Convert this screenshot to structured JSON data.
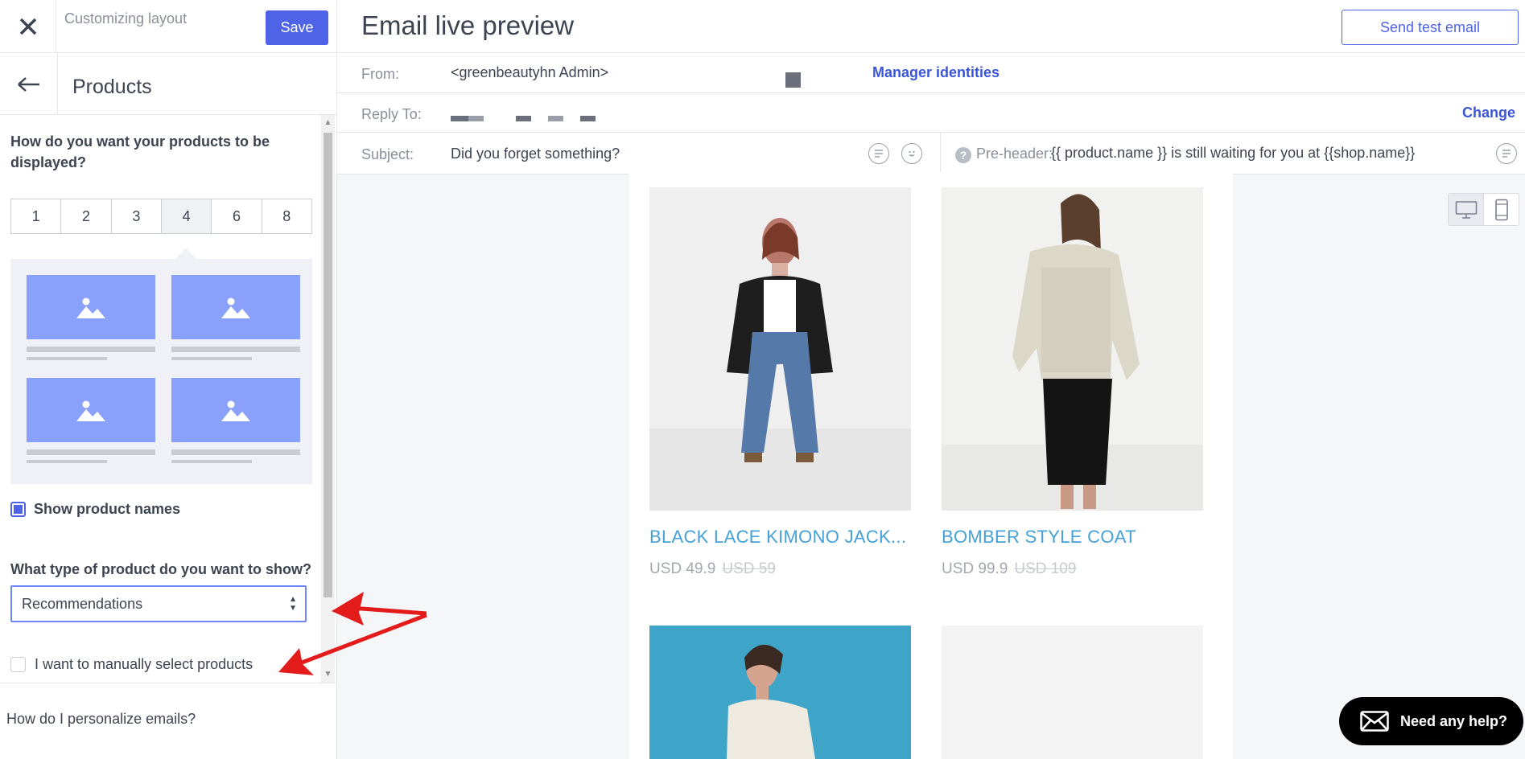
{
  "left_panel": {
    "title": "Customizing layout",
    "save_label": "Save",
    "section_title": "Products",
    "display_question": "How do you want your products to be displayed?",
    "columns_options": [
      "1",
      "2",
      "3",
      "4",
      "6",
      "8"
    ],
    "columns_selected": "4",
    "show_names_label": "Show product names",
    "show_names_checked": true,
    "type_question": "What type of product do you want to show?",
    "type_select_value": "Recommendations",
    "manual_label": "I want to manually select products",
    "manual_checked": false,
    "help_link": "How do I personalize emails?"
  },
  "header": {
    "title": "Email live preview",
    "send_test_label": "Send test email"
  },
  "from": {
    "label": "From:",
    "value": "<greenbeautyhn Admin>",
    "manager_link": "Manager identities"
  },
  "reply_to": {
    "label": "Reply To:",
    "change_link": "Change"
  },
  "subject": {
    "label": "Subject:",
    "value": "Did you forget something?",
    "preheader_label": "Pre-header:",
    "preheader_value": "{{ product.name }} is still waiting for you at {{shop.name}}"
  },
  "products": [
    {
      "name": "BLACK LACE KIMONO JACK...",
      "price": "USD 49.9",
      "old_price": "USD 59"
    },
    {
      "name": "BOMBER STYLE COAT",
      "price": "USD 99.9",
      "old_price": "USD 109"
    }
  ],
  "help_bubble": {
    "label": "Need any help?"
  },
  "colors": {
    "accent": "#4f63e8",
    "link": "#3a55d8",
    "product_name": "#45a1d8",
    "placeholder": "#8aa1fb"
  }
}
